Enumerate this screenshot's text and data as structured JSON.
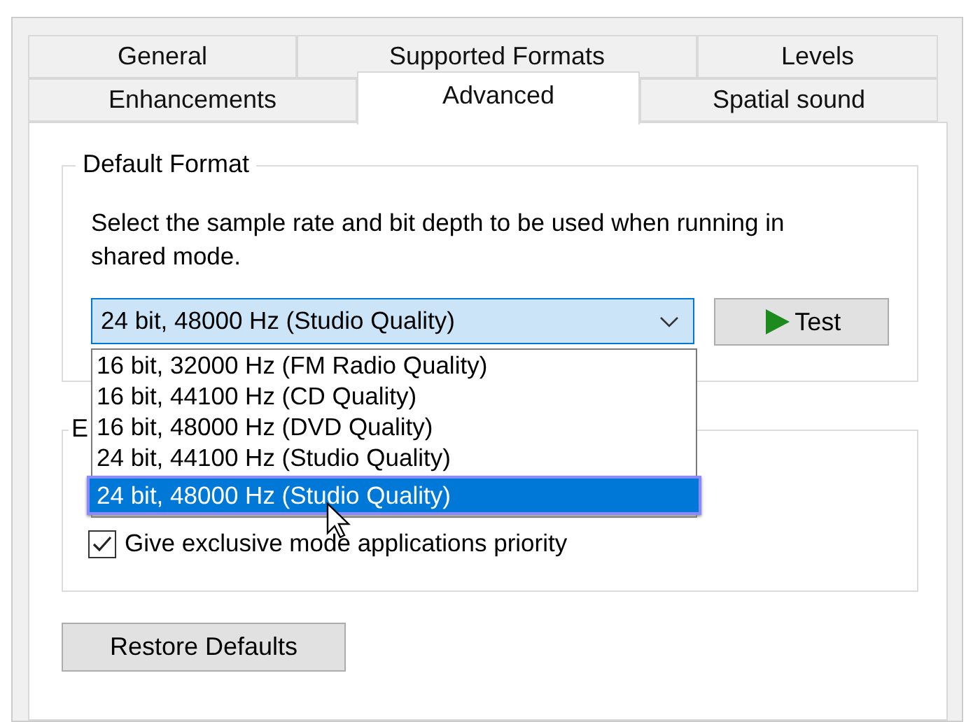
{
  "tabs_rows": [
    [
      {
        "label": "General",
        "selected": false
      },
      {
        "label": "Supported Formats",
        "selected": false
      },
      {
        "label": "Levels",
        "selected": false
      }
    ],
    [
      {
        "label": "Enhancements",
        "selected": false
      },
      {
        "label": "Advanced",
        "selected": true
      },
      {
        "label": "Spatial sound",
        "selected": false
      }
    ]
  ],
  "default_format": {
    "title": "Default Format",
    "description": "Select the sample rate and bit depth to be used when running in shared mode.",
    "value": "24 bit, 48000 Hz (Studio Quality)",
    "expanded": true,
    "options": [
      {
        "label": "16 bit, 32000 Hz (FM Radio Quality)",
        "selected": false
      },
      {
        "label": "16 bit, 44100 Hz (CD Quality)",
        "selected": false
      },
      {
        "label": "16 bit, 48000 Hz (DVD Quality)",
        "selected": false
      },
      {
        "label": "24 bit, 44100 Hz (Studio Quality)",
        "selected": false
      },
      {
        "label": "24 bit, 48000 Hz (Studio Quality)",
        "selected": true
      }
    ],
    "test_button": "Test"
  },
  "exclusive_mode": {
    "title": "E",
    "options": [
      {
        "label": "Give exclusive mode applications priority",
        "checked": true
      }
    ]
  },
  "restore_button": "Restore Defaults"
}
